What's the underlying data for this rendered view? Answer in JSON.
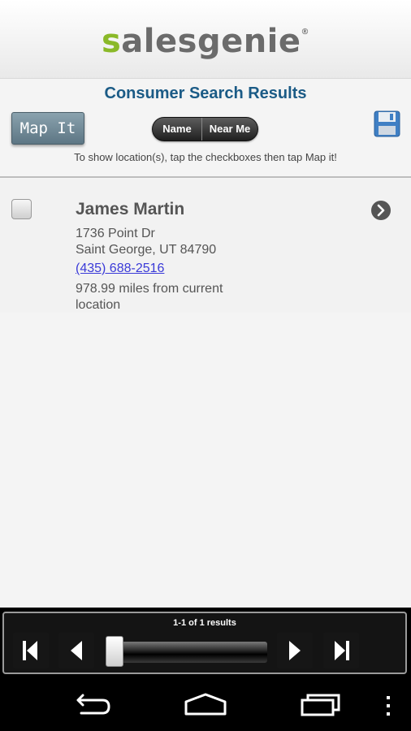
{
  "header": {
    "logo_s": "s",
    "logo_rest": "alesgenie",
    "logo_mark": "®"
  },
  "page_title": "Consumer Search Results",
  "toolbar": {
    "map_it_label": "Map It",
    "sort_options": [
      "Name",
      "Near Me"
    ],
    "save_icon": "floppy-disk-icon"
  },
  "hint_text": "To show location(s), tap the checkboxes then tap Map it!",
  "results": [
    {
      "name": "James Martin",
      "address_line1": "1736 Point Dr",
      "address_line2": "Saint George, UT 84790",
      "phone": "(435) 688-2516",
      "distance": "978.99 miles from current location",
      "checked": false
    }
  ],
  "pager": {
    "summary": "1-1 of 1 results",
    "position": 0.0
  },
  "colors": {
    "title": "#1b5b86",
    "brand_green": "#8ab928",
    "link": "#3a3ad8"
  },
  "system_nav": [
    "back-icon",
    "home-icon",
    "recent-apps-icon",
    "overflow-menu-icon"
  ]
}
